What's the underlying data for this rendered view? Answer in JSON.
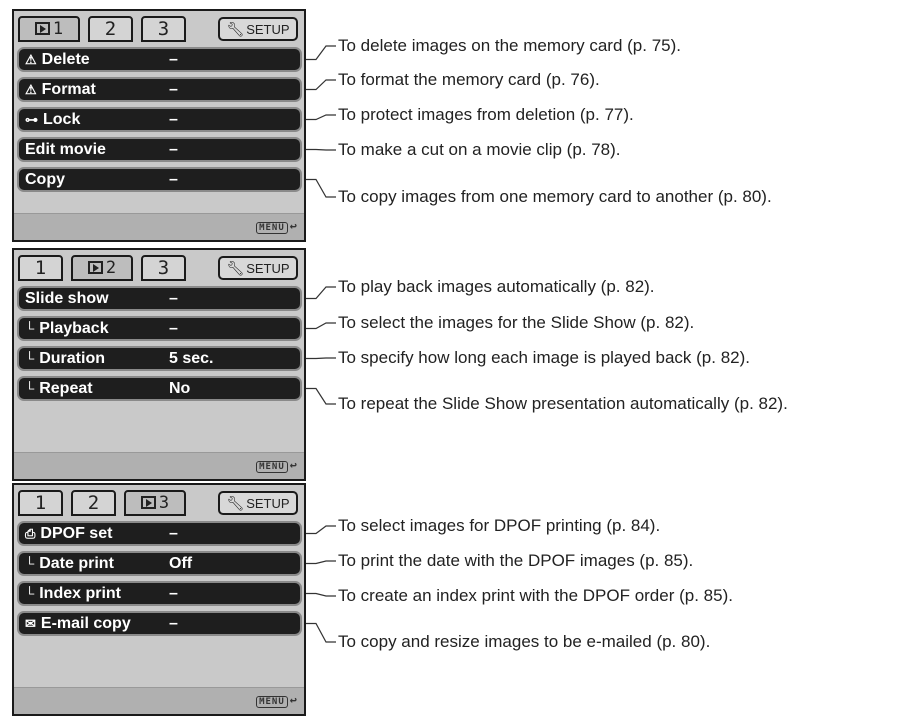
{
  "panels": [
    {
      "tabs": [
        "1",
        "2",
        "3"
      ],
      "active_tab": 0,
      "setup_label": "SETUP",
      "rows": [
        {
          "icon": "warning-icon",
          "glyph": "⚠",
          "label": "Delete",
          "value": "–"
        },
        {
          "icon": "warning-icon",
          "glyph": "⚠",
          "label": "Format",
          "value": "–"
        },
        {
          "icon": "key-icon",
          "glyph": "⊶",
          "label": "Lock",
          "value": "–"
        },
        {
          "icon": "",
          "glyph": "",
          "label": "Edit movie",
          "value": "–"
        },
        {
          "icon": "",
          "glyph": "",
          "label": "Copy",
          "value": "–"
        }
      ],
      "menu_label": "MENU",
      "descriptions": [
        "To delete images on the memory card (p. 75).",
        "To format the memory card (p. 76).",
        "To protect images from deletion (p. 77).",
        "To make a cut on a movie clip (p. 78).",
        "To copy images from one memory card to another (p. 80)."
      ]
    },
    {
      "tabs": [
        "1",
        "2",
        "3"
      ],
      "active_tab": 1,
      "setup_label": "SETUP",
      "rows": [
        {
          "icon": "",
          "glyph": "",
          "label": "Slide show",
          "value": "–"
        },
        {
          "icon": "sub-item-icon",
          "glyph": "└",
          "label": "Playback",
          "value": "–"
        },
        {
          "icon": "sub-item-icon",
          "glyph": "└",
          "label": "Duration",
          "value": "5 sec."
        },
        {
          "icon": "sub-item-icon",
          "glyph": "└",
          "label": "Repeat",
          "value": "No"
        }
      ],
      "menu_label": "MENU",
      "descriptions": [
        "To play back images automatically (p. 82).",
        "To select the images for the Slide Show (p. 82).",
        "To specify how long each image is played back (p. 82).",
        "To repeat the Slide Show presentation automatically (p. 82)."
      ]
    },
    {
      "tabs": [
        "1",
        "2",
        "3"
      ],
      "active_tab": 2,
      "setup_label": "SETUP",
      "rows": [
        {
          "icon": "print-icon",
          "glyph": "⎙",
          "label": "DPOF set",
          "value": "–"
        },
        {
          "icon": "sub-item-icon",
          "glyph": "└",
          "label": "Date print",
          "value": "Off"
        },
        {
          "icon": "sub-item-icon",
          "glyph": "└",
          "label": "Index print",
          "value": "–"
        },
        {
          "icon": "envelope-icon",
          "glyph": "✉",
          "label": "E-mail copy",
          "value": "–"
        }
      ],
      "menu_label": "MENU",
      "descriptions": [
        "To select images for DPOF printing (p. 84).",
        "To print the date with the DPOF images (p. 85).",
        "To create an index print with the DPOF order (p. 85).",
        "To copy and resize images to be e-mailed (p. 80)."
      ]
    }
  ]
}
